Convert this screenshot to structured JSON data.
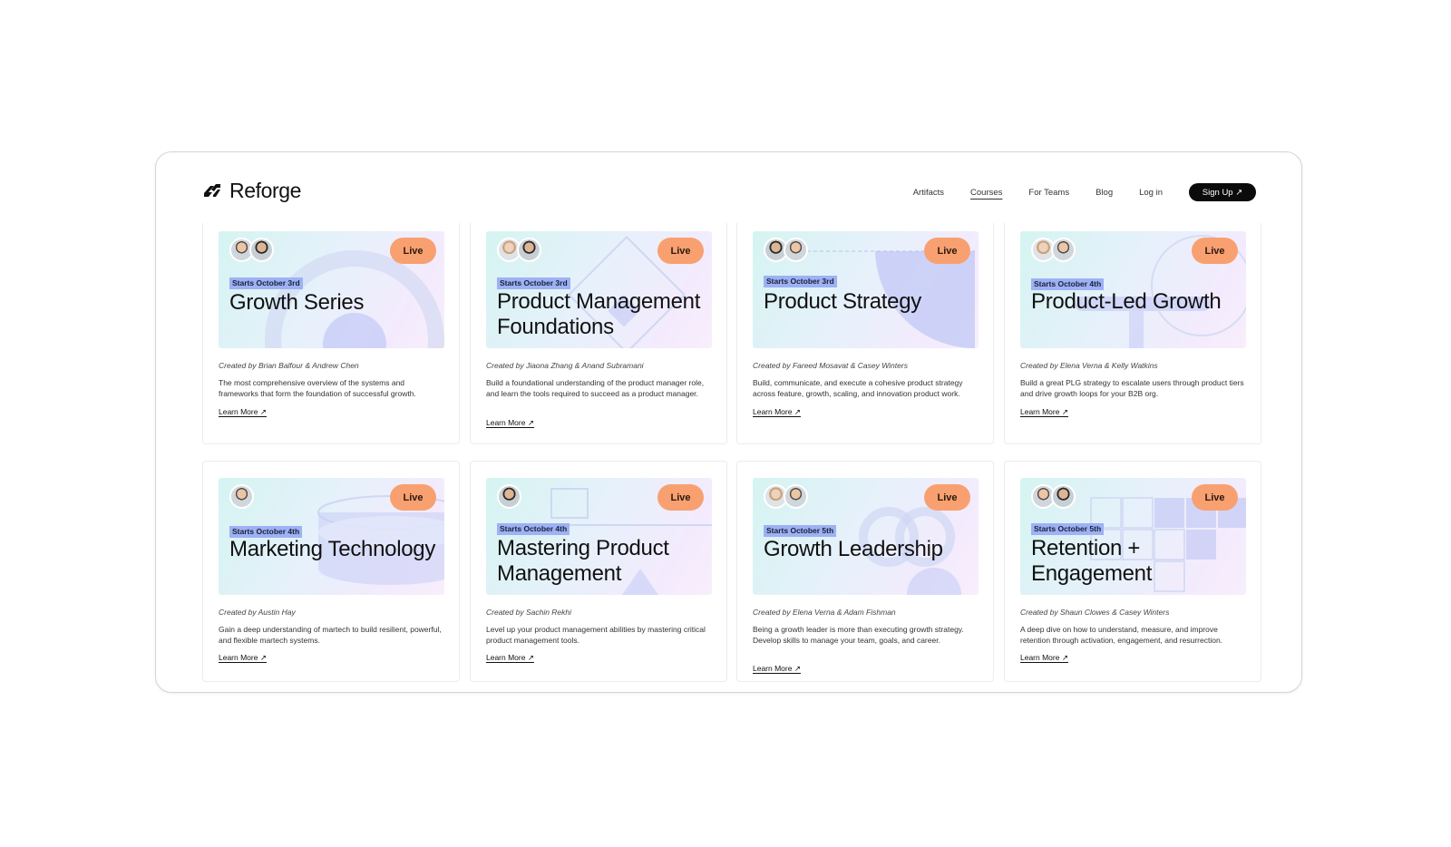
{
  "brand": {
    "name": "Reforge"
  },
  "nav": {
    "items": [
      "Artifacts",
      "Courses",
      "For Teams",
      "Blog",
      "Log in"
    ],
    "active": "Courses",
    "signup_label": "Sign Up ↗"
  },
  "courses": [
    {
      "live": "Live",
      "starts": "Starts October 3rd",
      "title": "Growth Series",
      "created": "Created by Brian Balfour & Andrew Chen",
      "description": "The most comprehensive overview of the systems and frameworks that form the foundation of successful growth.",
      "learn_more": "Learn More ↗",
      "avatars": 2
    },
    {
      "live": "Live",
      "starts": "Starts October 3rd",
      "title": "Product Management Foundations",
      "created": "Created by Jiaona Zhang & Anand Subramani",
      "description": "Build a foundational understanding of the product manager role, and learn the tools required to succeed as a product manager.",
      "learn_more": "Learn More ↗",
      "avatars": 2
    },
    {
      "live": "Live",
      "starts": "Starts October 3rd",
      "title": "Product Strategy",
      "created": "Created by Fareed Mosavat & Casey Winters",
      "description": "Build, communicate, and execute a cohesive product strategy across feature, growth, scaling, and innovation product work.",
      "learn_more": "Learn More ↗",
      "avatars": 2
    },
    {
      "live": "Live",
      "starts": "Starts October 4th",
      "title": "Product-Led Growth",
      "created": "Created by Elena Verna & Kelly Watkins",
      "description": "Build a great PLG strategy to escalate users through product tiers and drive growth loops for your B2B org.",
      "learn_more": "Learn More ↗",
      "avatars": 2
    },
    {
      "live": "Live",
      "starts": "Starts October 4th",
      "title": "Marketing Technology",
      "created": "Created by Austin Hay",
      "description": "Gain a deep understanding of martech to build resilient, powerful, and flexible martech systems.",
      "learn_more": "Learn More ↗",
      "avatars": 1
    },
    {
      "live": "Live",
      "starts": "Starts October 4th",
      "title": "Mastering Product Management",
      "created": "Created by Sachin Rekhi",
      "description": "Level up your product management abilities by mastering critical product management tools.",
      "learn_more": "Learn More ↗",
      "avatars": 1
    },
    {
      "live": "Live",
      "starts": "Starts October 5th",
      "title": "Growth Leadership",
      "created": "Created by Elena Verna & Adam Fishman",
      "description": "Being a growth leader is more than executing growth strategy. Develop skills to manage your team, goals, and career.",
      "learn_more": "Learn More ↗",
      "avatars": 2
    },
    {
      "live": "Live",
      "starts": "Starts October 5th",
      "title": "Retention + Engagement",
      "created": "Created by Shaun Clowes & Casey Winters",
      "description": "A deep dive on how to understand, measure, and improve retention through activation, engagement, and resurrection.",
      "learn_more": "Learn More ↗",
      "avatars": 2
    }
  ]
}
